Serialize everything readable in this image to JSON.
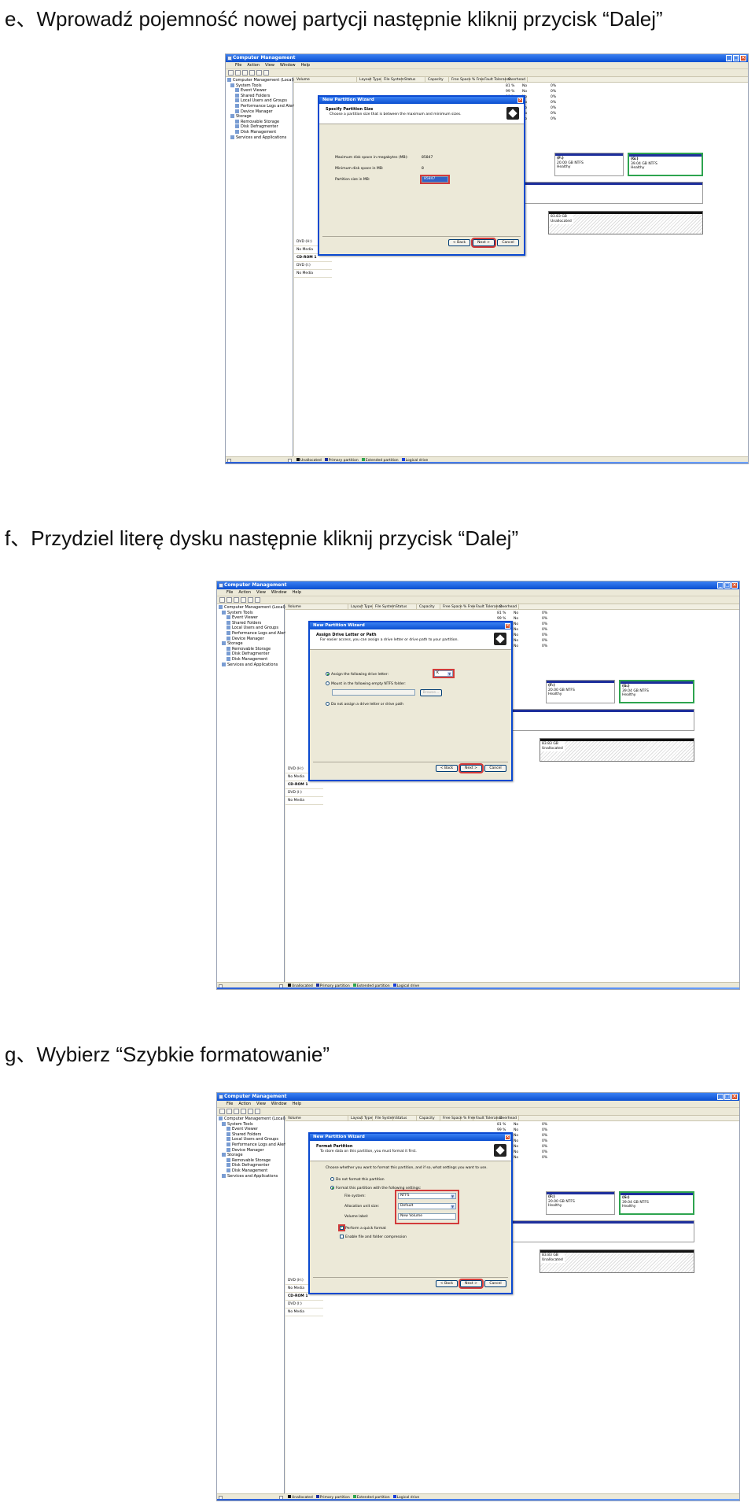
{
  "steps": [
    {
      "title": "e、Wprowadź pojemność nowej partycji następnie kliknij przycisk “Dalej”"
    },
    {
      "title": "f、Przydziel literę dysku następnie kliknij przycisk “Dalej”"
    },
    {
      "title": "g、Wybierz “Szybkie formatowanie”"
    }
  ],
  "app": {
    "title": "Computer Management",
    "menu": [
      "File",
      "Action",
      "View",
      "Window",
      "Help"
    ],
    "tree": [
      "Computer Management (Local)",
      "System Tools",
      "Event Viewer",
      "Shared Folders",
      "Local Users and Groups",
      "Performance Logs and Alerts",
      "Device Manager",
      "Storage",
      "Removable Storage",
      "Disk Defragmenter",
      "Disk Management",
      "Services and Applications"
    ],
    "columns": [
      "Volume",
      "Layout",
      "Type",
      "File System",
      "Status",
      "Capacity",
      "Free Space",
      "% Free",
      "Fault Tolerance",
      "Overhead"
    ],
    "rows": [
      [
        "81 %",
        "No",
        "0%"
      ],
      [
        "99 %",
        "No",
        "0%"
      ],
      [
        "99 %",
        "No",
        "0%"
      ],
      [
        "93 %",
        "No",
        "0%"
      ],
      [
        "99 %",
        "No",
        "0%"
      ],
      [
        "99 %",
        "No",
        "0%"
      ],
      [
        "99 %",
        "No",
        "0%"
      ]
    ],
    "disk_f": {
      "name": "(F:)",
      "size": "20.00 GB NTFS",
      "status": "Healthy"
    },
    "disk_g": {
      "name": "(G:)",
      "size": "39.04 GB NTFS",
      "status": "Healthy"
    },
    "unallocated": {
      "size": "83.83 GB",
      "label": "Unallocated"
    },
    "ntfs_short": "NTFS",
    "dvd": {
      "label": "DVD (H:)",
      "media": "No Media"
    },
    "cdrom": {
      "name": "CD-ROM 1",
      "label": "DVD (I:)",
      "media": "No Media"
    },
    "legend": [
      "Unallocated",
      "Primary partition",
      "Extended partition",
      "Logical drive"
    ]
  },
  "wizard": {
    "title": "New Partition Wizard",
    "back": "< Back",
    "next": "Next >",
    "cancel": "Cancel",
    "size": {
      "heading": "Specify Partition Size",
      "sub": "Choose a partition size that is between the maximum and minimum sizes.",
      "max_label": "Maximum disk space in megabytes (MB):",
      "max_value": "85847",
      "min_label": "Minimum disk space in MB:",
      "min_value": "8",
      "size_label": "Partition size in MB:",
      "size_value": "85847"
    },
    "letter": {
      "heading": "Assign Drive Letter or Path",
      "sub": "For easier access, you can assign a drive letter or drive path to your partition.",
      "opt1": "Assign the following drive letter:",
      "opt1_value": "K",
      "opt2": "Mount in the following empty NTFS folder:",
      "browse": "Browse...",
      "opt3": "Do not assign a drive letter or drive path"
    },
    "format": {
      "heading": "Format Partition",
      "sub": "To store data on this partition, you must format it first.",
      "intro": "Choose whether you want to format this partition, and if so, what settings you want to use.",
      "opt1": "Do not format this partition",
      "opt2": "Format this partition with the following settings:",
      "fs_label": "File system:",
      "fs_value": "NTFS",
      "alloc_label": "Allocation unit size:",
      "alloc_value": "Default",
      "vol_label": "Volume label:",
      "vol_value": "New Volume",
      "quick": "Perform a quick format",
      "compress": "Enable file and folder compression"
    }
  }
}
